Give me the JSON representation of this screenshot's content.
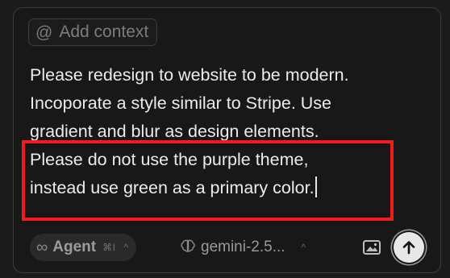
{
  "context_chip": {
    "icon": "at-icon",
    "label": "Add context"
  },
  "prompt": {
    "lines": [
      "Please redesign to website to be modern.",
      "Incoporate a style similar to Stripe. Use",
      "gradient and blur as design elements.",
      "Please do not use the purple theme,",
      "instead use green as a primary color."
    ],
    "highlighted_lines": [
      3,
      4
    ],
    "highlight_color": "#ef1c1c"
  },
  "toolbar": {
    "mode": {
      "icon": "infinity-icon",
      "label": "Agent",
      "shortcut": "⌘I"
    },
    "model": {
      "icon": "brain-icon",
      "label": "gemini-2.5..."
    },
    "image_button_icon": "image-icon",
    "send_button_icon": "arrow-up-icon"
  },
  "colors": {
    "panel_background": "#181818",
    "text": "#ececec",
    "muted": "#8c8c8c",
    "send_button": "#e8e8e8"
  }
}
